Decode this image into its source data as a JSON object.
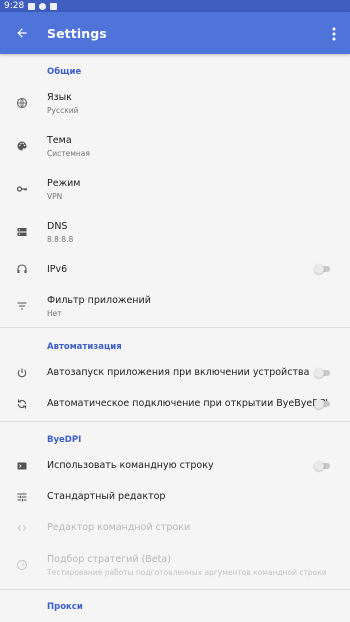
{
  "status_bar": {
    "time": "9:28"
  },
  "app_bar": {
    "title": "Settings"
  },
  "sections": {
    "general": {
      "header": "Общие",
      "language": {
        "title": "Язык",
        "summary": "Русский"
      },
      "theme": {
        "title": "Тема",
        "summary": "Системная"
      },
      "mode": {
        "title": "Режим",
        "summary": "VPN"
      },
      "dns": {
        "title": "DNS",
        "summary": "8.8.8.8"
      },
      "ipv6": {
        "title": "IPv6",
        "enabled": false
      },
      "app_filter": {
        "title": "Фильтр приложений",
        "summary": "Нет"
      }
    },
    "automation": {
      "header": "Автоматизация",
      "autostart": {
        "title": "Автозапуск приложения при включении устройства",
        "enabled": false
      },
      "autoconnect": {
        "title": "Автоматическое подключение при открытии ByeByeDPI",
        "enabled": false
      }
    },
    "byedpi": {
      "header": "ByeDPI",
      "use_cmd": {
        "title": "Использовать командную строку",
        "enabled": false
      },
      "standard_editor": {
        "title": "Стандартный редактор"
      },
      "cmd_editor": {
        "title": "Редактор командной строки"
      },
      "strategy_picker": {
        "title": "Подбор стратегий (Beta)",
        "summary": "Тестирование работы подготовленных аргументов командной строки"
      }
    },
    "proxy": {
      "header": "Прокси"
    }
  },
  "colors": {
    "accent": "#4f74d9",
    "status_bar": "#3f5dbf",
    "section_header": "#3d5fcc"
  },
  "icons": {
    "language": "globe-icon",
    "theme": "palette-icon",
    "mode": "key-icon",
    "dns": "dns-server-icon",
    "ipv6": "headset-icon",
    "app_filter": "filter-icon",
    "autostart": "power-icon",
    "autoconnect": "sync-icon",
    "use_cmd": "terminal-icon",
    "standard_editor": "tune-icon",
    "cmd_editor": "code-icon",
    "strategy_picker": "speedometer-icon"
  }
}
